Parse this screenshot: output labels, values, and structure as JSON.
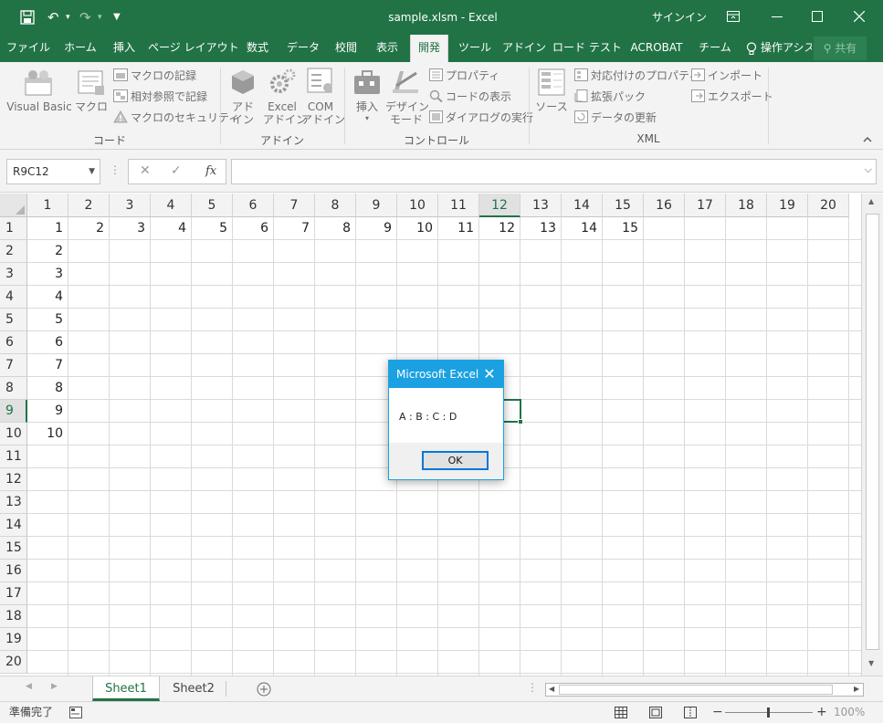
{
  "window": {
    "title": "sample.xlsm - Excel",
    "signin": "サインイン"
  },
  "tabs": [
    "ファイル",
    "ホーム",
    "挿入",
    "ページ レイアウト",
    "数式",
    "データ",
    "校閲",
    "表示",
    "開発",
    "ツール",
    "アドイン",
    "ロード テスト",
    "ACROBAT",
    "チーム",
    "操作アシス"
  ],
  "active_tab": "開発",
  "share_label": "共有",
  "ribbon": {
    "code": {
      "label": "コード",
      "visual_basic": "Visual Basic",
      "macro": "マクロ",
      "record_macro": "マクロの記録",
      "relative_ref": "相対参照で記録",
      "macro_security": "マクロのセキュリティ"
    },
    "addins": {
      "label": "アドイン",
      "addin_l1": "アド",
      "addin_l2": "イン",
      "excel_addin_l1": "Excel",
      "excel_addin_l2": "アドイン",
      "com_addin_l1": "COM",
      "com_addin_l2": "アドイン"
    },
    "controls": {
      "label": "コントロール",
      "insert": "挿入",
      "design_l1": "デザイン",
      "design_l2": "モード",
      "properties": "プロパティ",
      "view_code": "コードの表示",
      "run_dialog": "ダイアログの実行"
    },
    "xml": {
      "label": "XML",
      "source": "ソース",
      "map_props": "対応付けのプロパティ",
      "expansion": "拡張パック",
      "refresh": "データの更新",
      "import": "インポート",
      "export": "エクスポート"
    }
  },
  "formula_bar": {
    "name_box": "R9C12",
    "fx": "fx",
    "value": ""
  },
  "grid": {
    "columns": [
      "1",
      "2",
      "3",
      "4",
      "5",
      "6",
      "7",
      "8",
      "9",
      "10",
      "11",
      "12",
      "13",
      "14",
      "15",
      "16",
      "17",
      "18",
      "19",
      "20"
    ],
    "rows": [
      "1",
      "2",
      "3",
      "4",
      "5",
      "6",
      "7",
      "8",
      "9",
      "10",
      "11",
      "12",
      "13",
      "14",
      "15",
      "16",
      "17",
      "18",
      "19",
      "20"
    ],
    "selected_col": "12",
    "selected_row": "9",
    "row1_values": [
      "1",
      "2",
      "3",
      "4",
      "5",
      "6",
      "7",
      "8",
      "9",
      "10",
      "11",
      "12",
      "13",
      "14",
      "15"
    ],
    "col1_values": [
      "2",
      "3",
      "4",
      "5",
      "6",
      "7",
      "8",
      "9",
      "10"
    ]
  },
  "sheets": [
    "Sheet1",
    "Sheet2"
  ],
  "active_sheet": "Sheet1",
  "status": {
    "ready": "準備完了",
    "zoom": "100%"
  },
  "dialog": {
    "title": "Microsoft Excel",
    "message": "A : B : C : D",
    "ok": "OK"
  },
  "colors": {
    "excel_green": "#217346",
    "dialog_blue": "#1ba1e2"
  }
}
